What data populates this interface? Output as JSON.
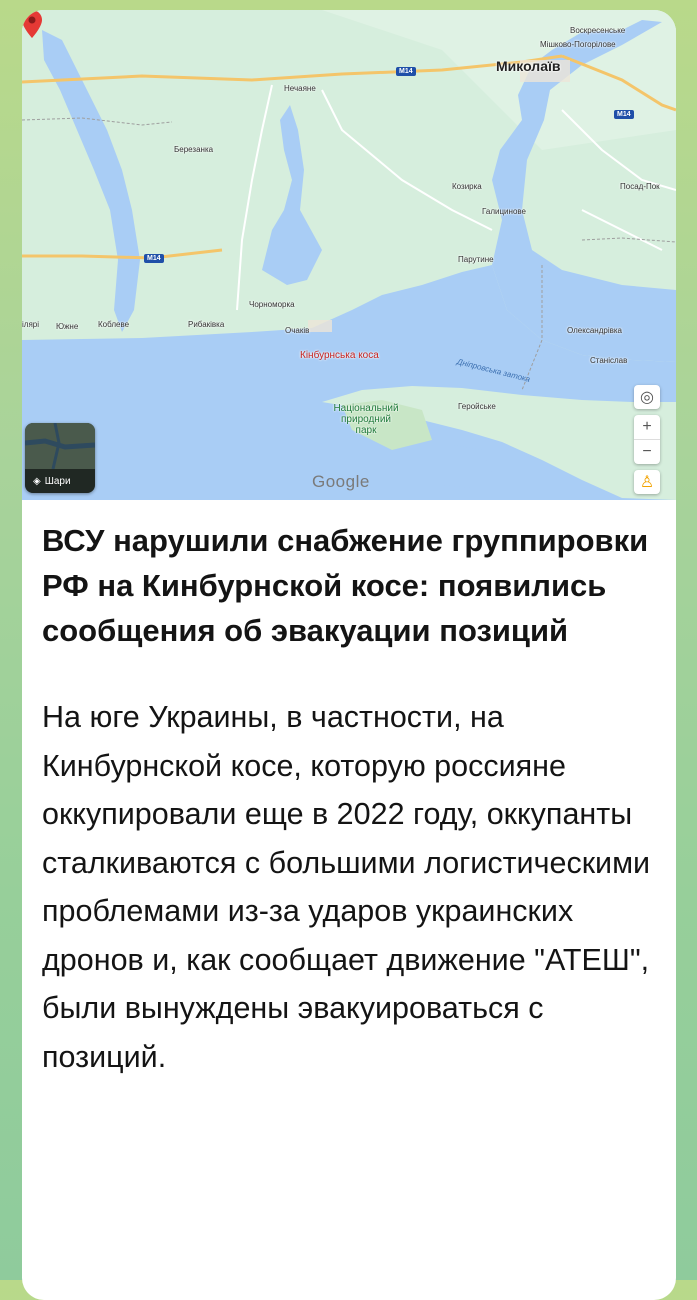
{
  "map": {
    "places": {
      "voskresenske": "Воскресенське",
      "mishkovo": "Мішково-Погорілове",
      "mykolaiv": "Миколаїв",
      "nechaiane": "Нечаяне",
      "berezanka": "Березанка",
      "kozyrka": "Козирка",
      "halytsynove": "Галицинове",
      "posad_pok": "Посад-Пок",
      "parutyne": "Парутине",
      "chornomorka": "Чорноморка",
      "ochakiv": "Очаків",
      "lari": "ілярі",
      "yuzhne": "Южне",
      "koblevo": "Коблеве",
      "rybakivka": "Рибаківка",
      "oleksandrivka": "Олександрівка",
      "stanislav": "Станіслав",
      "heroiske": "Геройське",
      "dniprovska": "Дніпровська затока",
      "park": "Національний природний парк"
    },
    "marker_label": "Кінбурнська коса",
    "road_shields": [
      "M14",
      "M14",
      "M14"
    ],
    "layers_label": "Шари",
    "attribution": "Google",
    "controls": {
      "zoom_in": "+",
      "zoom_out": "−"
    }
  },
  "article": {
    "headline": "ВСУ нарушили снабжение группировки РФ на Кинбурнской косе: появились сообщения об эвакуации позиций",
    "body": "На юге Украины, в частности, на Кинбурнской косе, которую россияне оккупировали еще в 2022 году, оккупанты сталкиваются с большими логистическими проблемами из-за ударов украинских дронов и, как сообщает движение \"АТЕШ\", были вынуждены эвакуироваться с позиций."
  },
  "colors": {
    "water": "#a9cdf5",
    "land": "#d7eedf",
    "marker": "#e53935"
  }
}
